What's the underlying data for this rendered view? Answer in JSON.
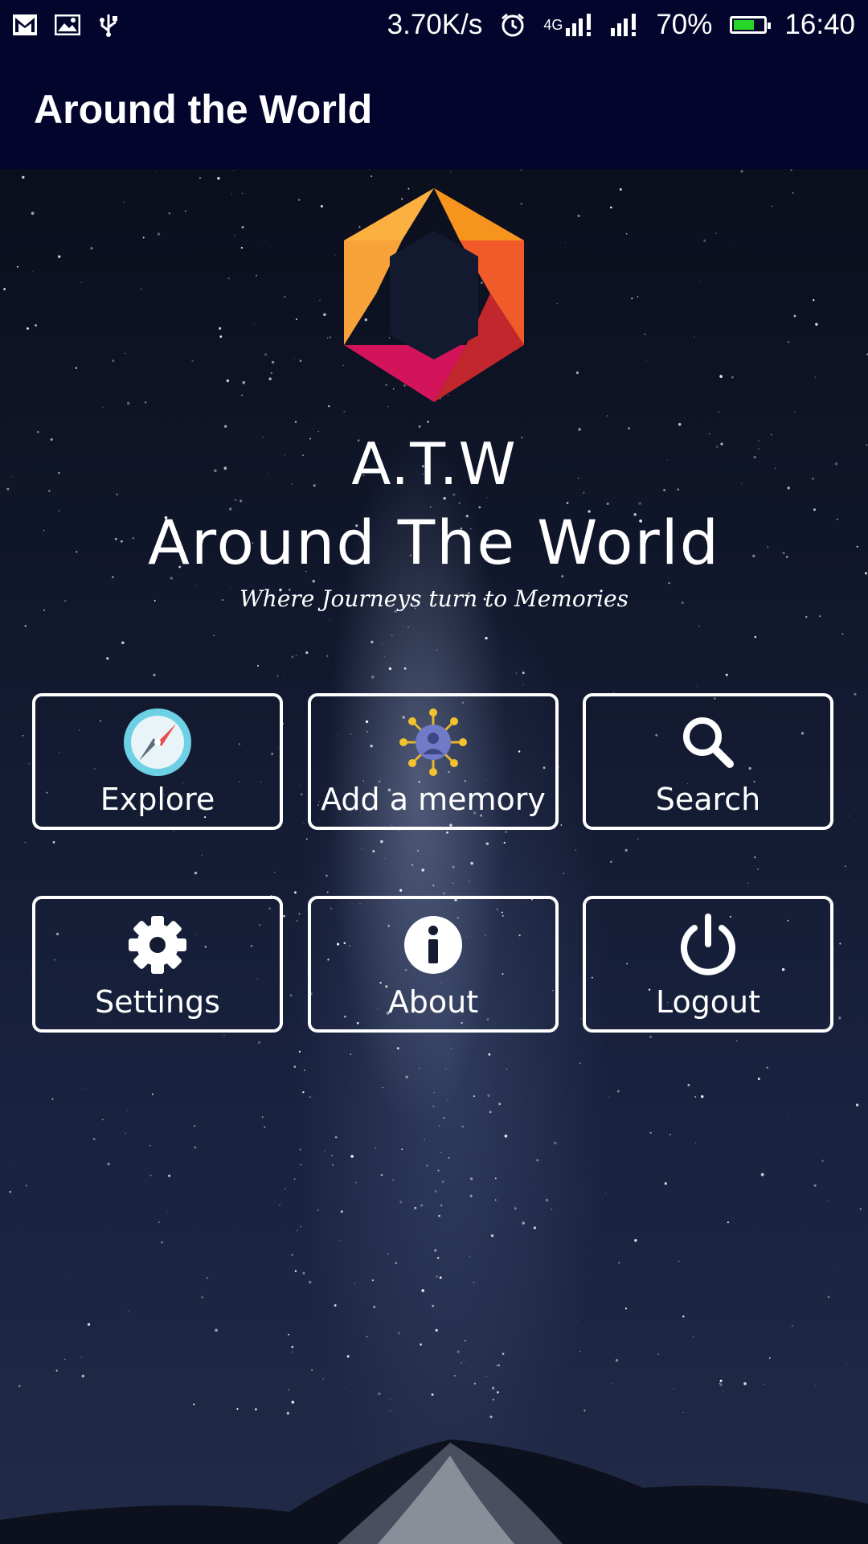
{
  "status_bar": {
    "net_speed": "3.70K/s",
    "network_type": "4G",
    "battery": "70%",
    "battery_level": 0.7,
    "time": "16:40",
    "icons": [
      "gmail-icon",
      "gallery-icon",
      "usb-icon",
      "alarm-icon",
      "signal-icon",
      "signal-icon",
      "battery-icon"
    ]
  },
  "app_bar": {
    "title": "Around the World"
  },
  "hero": {
    "short_name": "A.T.W",
    "full_name": "Around The World",
    "tagline": "Where Journeys turn to Memories"
  },
  "menu": [
    {
      "label": "Explore",
      "icon": "compass-icon"
    },
    {
      "label": "Add a memory",
      "icon": "add-memory-icon"
    },
    {
      "label": "Search",
      "icon": "search-icon"
    },
    {
      "label": "Settings",
      "icon": "gear-icon"
    },
    {
      "label": "About",
      "icon": "info-icon"
    },
    {
      "label": "Logout",
      "icon": "power-icon"
    }
  ],
  "colors": {
    "bar_background": "#03052c",
    "logo_orange": "#f7941d",
    "logo_red": "#c1272d",
    "logo_pink": "#d4145a",
    "battery_green": "#27d628"
  }
}
